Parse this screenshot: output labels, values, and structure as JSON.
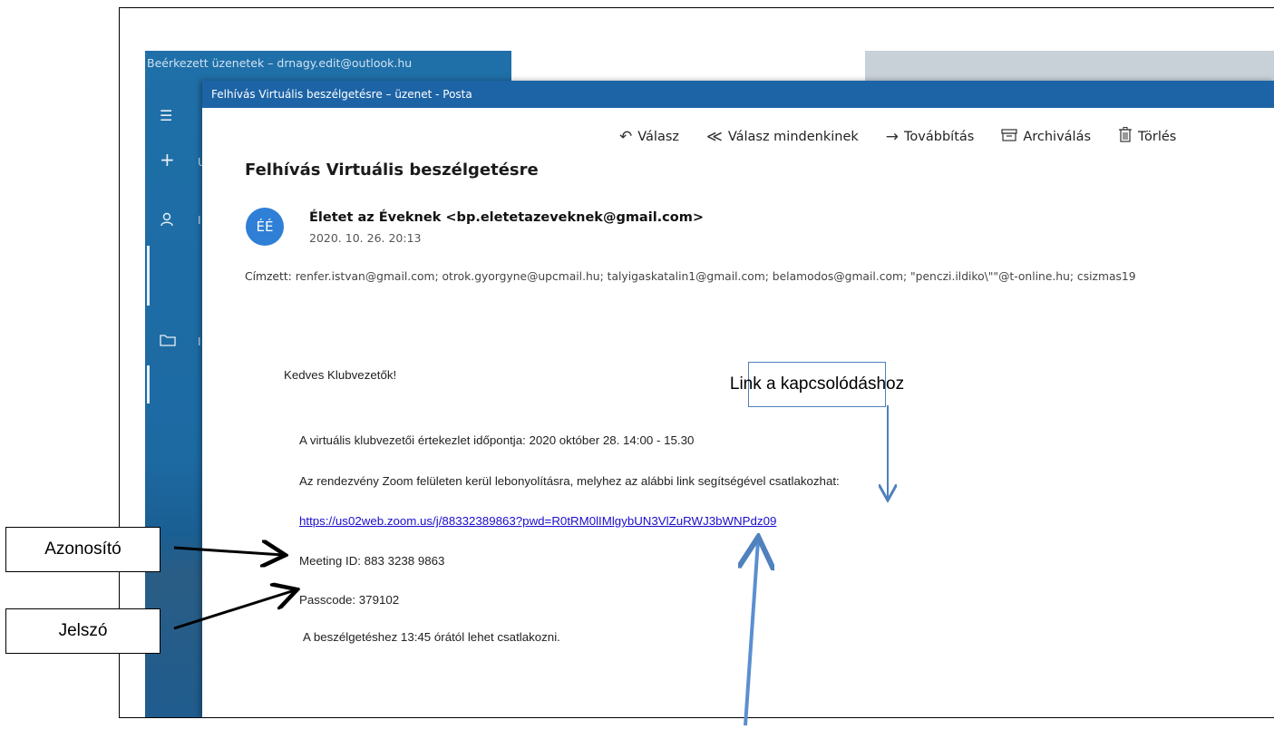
{
  "background_app": {
    "title": "Beérkezett üzenetek – drnagy.edit@outlook.hu",
    "side_icons": [
      "hamburger-icon",
      "plus-icon",
      "person-icon",
      "folder-icon"
    ],
    "side_letters": [
      "U",
      "I",
      "I"
    ]
  },
  "window": {
    "title": "Felhívás Virtuális beszélgetésre – üzenet - Posta"
  },
  "toolbar": {
    "reply": "Válasz",
    "reply_all": "Válasz mindenkinek",
    "forward": "Továbbítás",
    "archive": "Archiválás",
    "delete": "Törlés"
  },
  "message": {
    "subject": "Felhívás Virtuális beszélgetésre",
    "avatar_initials": "ÉÉ",
    "sender": "Életet az Éveknek <bp.eletetazeveknek@gmail.com>",
    "date": "2020. 10. 26. 20:13",
    "recipients_label": "Címzett:",
    "recipients": "renfer.istvan@gmail.com; otrok.gyorgyne@upcmail.hu; talyigaskatalin1@gmail.com; belamodos@gmail.com; \"penczi.ildiko\\\"\"@t-online.hu; csizmas19",
    "body": {
      "greeting": "Kedves Klubvezetők!",
      "line1": "A  virtuális klubvezetői értekezlet időpontja: 2020 október 28. 14:00 - 15.30",
      "line2": "Az rendezvény Zoom felületen kerül lebonyolításra, melyhez az alábbi link segítségével csatlakozhat:",
      "link": "https://us02web.zoom.us/j/88332389863?pwd=R0tRM0lIMlgybUN3VlZuRWJ3bWNPdz09",
      "meeting_id": "Meeting ID: 883 3238 9863",
      "passcode": "Passcode: 379102",
      "join_note": "A beszélgetéshez 13:45 órától lehet csatlakozni."
    }
  },
  "callouts": {
    "link": "Link a kapcsolódáshoz",
    "id": "Azonosító",
    "password": "Jelszó"
  },
  "colors": {
    "title_bar": "#1d64a6",
    "link": "#1a0dcc",
    "avatar": "#2f7fd6",
    "callout_arrow_blue": "#4f81bd"
  }
}
